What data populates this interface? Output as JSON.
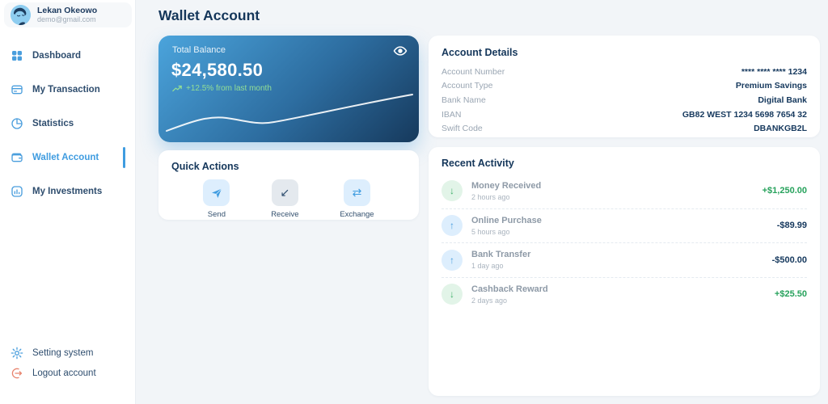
{
  "page_title": "Wallet Account",
  "colors": {
    "accent_blue": "#3f9ce0",
    "navy_text": "#16395e",
    "positive_green": "#27a25c",
    "logout_salmon": "#e8846e",
    "balance_gradient_start": "#4ba4dc",
    "balance_gradient_end": "#16395c"
  },
  "icons": {
    "arrow_down": "↓",
    "arrow_up": "↑",
    "arrow_down_left": "↙",
    "arrow_left_right": "⇄"
  },
  "sidebar": {
    "user": {
      "name": "Lekan Okeowo",
      "email": "demo@gmail.com"
    },
    "items": [
      {
        "label": "Dashboard",
        "icon": "grid-icon",
        "active": false
      },
      {
        "label": "My Transaction",
        "icon": "transaction-icon",
        "active": false
      },
      {
        "label": "Statistics",
        "icon": "pie-chart-icon",
        "active": false
      },
      {
        "label": "Wallet Account",
        "icon": "wallet-icon",
        "active": true
      },
      {
        "label": "My Investments",
        "icon": "investments-icon",
        "active": false
      }
    ],
    "footer_items": [
      {
        "label": "Setting system",
        "icon": "gear-icon"
      },
      {
        "label": "Logout account",
        "icon": "logout-icon"
      }
    ]
  },
  "balance_card": {
    "label": "Total Balance",
    "amount": "$24,580.50",
    "trend": "+12.5% from last month"
  },
  "account_details": {
    "title": "Account Details",
    "rows": [
      {
        "label": "Account Number",
        "value": "**** **** **** 1234"
      },
      {
        "label": "Account Type",
        "value": "Premium Savings"
      },
      {
        "label": "Bank Name",
        "value": "Digital Bank"
      },
      {
        "label": "IBAN",
        "value": "GB82 WEST 1234 5698 7654 32"
      },
      {
        "label": "Swift Code",
        "value": "DBANKGB2L"
      }
    ]
  },
  "quick_actions": {
    "title": "Quick Actions",
    "actions": [
      {
        "label": "Send",
        "icon": "send-icon"
      },
      {
        "label": "Receive",
        "icon": "receive-icon"
      },
      {
        "label": "Exchange",
        "icon": "exchange-icon"
      }
    ]
  },
  "recent_activity": {
    "title": "Recent Activity",
    "items": [
      {
        "title": "Money Received",
        "time": "2 hours ago",
        "amount": "+$1,250.00",
        "direction": "in"
      },
      {
        "title": "Online Purchase",
        "time": "5 hours ago",
        "amount": "-$89.99",
        "direction": "out"
      },
      {
        "title": "Bank Transfer",
        "time": "1 day ago",
        "amount": "-$500.00",
        "direction": "out"
      },
      {
        "title": "Cashback Reward",
        "time": "2 days ago",
        "amount": "+$25.50",
        "direction": "in"
      }
    ]
  }
}
